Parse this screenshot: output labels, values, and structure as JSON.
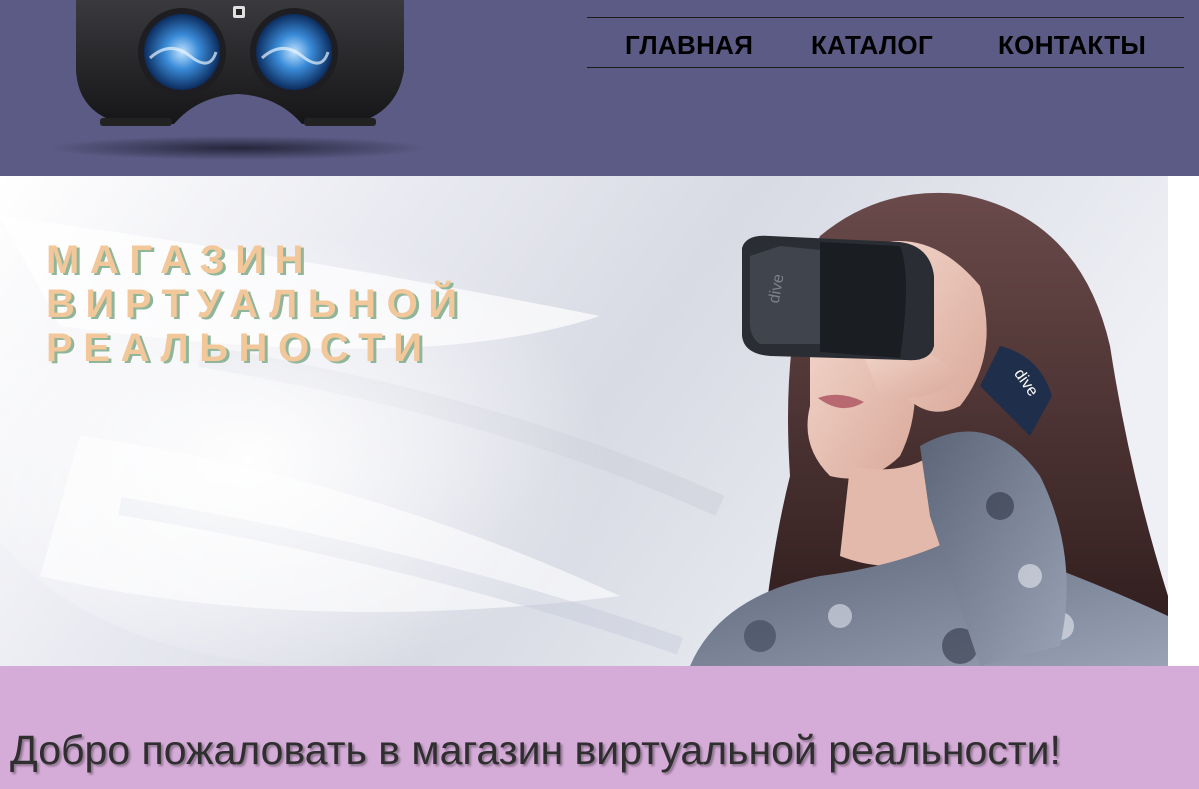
{
  "nav": {
    "items": [
      {
        "label": "ГЛАВНАЯ"
      },
      {
        "label": "КАТАЛОГ"
      },
      {
        "label": "КОНТАКТЫ"
      }
    ]
  },
  "hero": {
    "title_lines": [
      "МАГАЗИН",
      "ВИРТУАЛЬНОЙ",
      "РЕАЛЬНОСТИ"
    ],
    "headset_brand": "dive"
  },
  "welcome": {
    "heading": "Добро пожаловать в магазин виртуальной реальности!"
  },
  "colors": {
    "header_bg": "#5b5b85",
    "welcome_bg": "#d5acd8",
    "title_fill": "#f2c79a",
    "title_shadow": "#8fb59a"
  },
  "icons": {
    "logo": "vr-headset-icon"
  }
}
